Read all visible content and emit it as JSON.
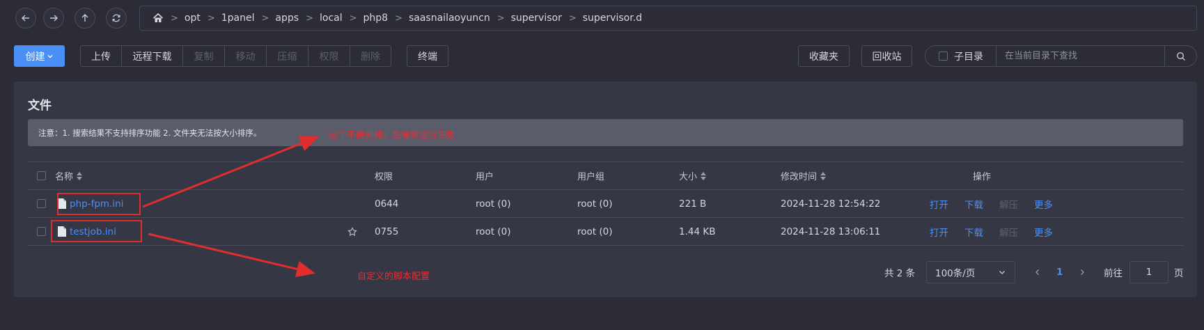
{
  "nav": {
    "back_icon": "arrow-left-icon",
    "forward_icon": "arrow-right-icon",
    "up_icon": "arrow-up-icon",
    "refresh_icon": "refresh-icon"
  },
  "breadcrumb": {
    "home_icon": "home-icon",
    "separator": ">",
    "items": [
      "opt",
      "1panel",
      "apps",
      "local",
      "php8",
      "saasnailaoyuncn",
      "supervisor",
      "supervisor.d"
    ]
  },
  "toolbar": {
    "create_label": "创建",
    "group": [
      "上传",
      "远程下载",
      "复制",
      "移动",
      "压缩",
      "权限",
      "删除"
    ],
    "terminal_label": "终端",
    "favorites_label": "收藏夹",
    "recycle_label": "回收站",
    "subdir_label": "子目录",
    "search_placeholder": "在当前目录下查找"
  },
  "panel": {
    "title": "文件",
    "notice": "注意：1. 搜索结果不支持排序功能 2. 文件夹无法按大小排序。"
  },
  "table": {
    "columns": {
      "name": "名称",
      "permission": "权限",
      "user": "用户",
      "group": "用户组",
      "size": "大小",
      "mtime": "修改时间",
      "actions": "操作"
    },
    "rows": [
      {
        "name": "php-fpm.ini",
        "permission": "0644",
        "user": "root (0)",
        "group": "root (0)",
        "size": "221 B",
        "mtime": "2024-11-28 12:54:22",
        "actions": [
          "打开",
          "下载",
          "解压",
          "更多"
        ]
      },
      {
        "name": "testjob.ini",
        "permission": "0755",
        "user": "root (0)",
        "group": "root (0)",
        "size": "1.44 KB",
        "mtime": "2024-11-28 13:06:11",
        "actions": [
          "打开",
          "下载",
          "解压",
          "更多"
        ]
      }
    ]
  },
  "pagination": {
    "total": "共 2 条",
    "page_size": "100条/页",
    "current": "1",
    "goto_label": "前往",
    "goto_value": "1",
    "page_suffix": "页"
  },
  "annotations": {
    "note1": "这个不要删掉，会导致运行失败",
    "note2": "自定义的脚本配置"
  },
  "colors": {
    "accent": "#4a8ff7",
    "annotation": "#e0303a",
    "background": "#2b2c36",
    "panel": "#363744"
  }
}
